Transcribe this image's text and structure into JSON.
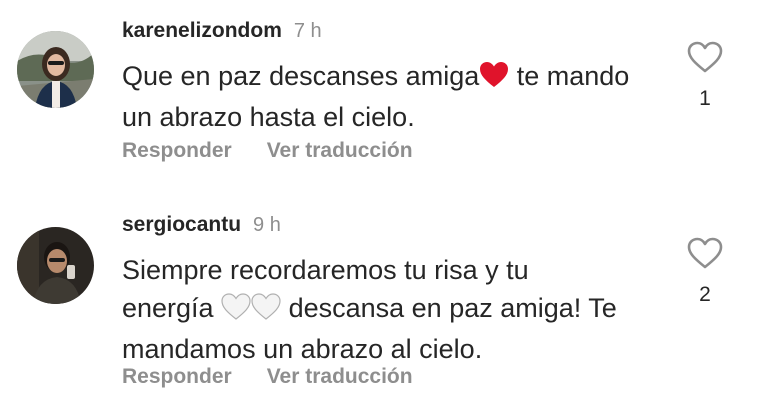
{
  "comments": [
    {
      "username": "karenelizondom",
      "time": "7 h",
      "text_line1_before": "Que en paz descanses amiga",
      "text_line1_after": " te mando",
      "text_line2": "un abrazo hasta el cielo.",
      "likes": "1",
      "reply_label": "Responder",
      "translate_label": "Ver traducción"
    },
    {
      "username": "sergiocantu",
      "time": "9 h",
      "text_line1": "Siempre recordaremos tu risa y tu",
      "text_line2_before": "energía ",
      "text_line2_after": " descansa en paz amiga! Te",
      "text_line3": "mandamos un abrazo al cielo.",
      "likes": "2",
      "reply_label": "Responder",
      "translate_label": "Ver traducción"
    }
  ],
  "icons": {
    "emoji_red_heart": "red-heart-emoji",
    "emoji_white_heart": "white-heart-emoji",
    "like": "heart-outline-icon"
  },
  "colors": {
    "text": "#262626",
    "muted": "#8e8e8e",
    "heart_red": "#e0132b"
  }
}
